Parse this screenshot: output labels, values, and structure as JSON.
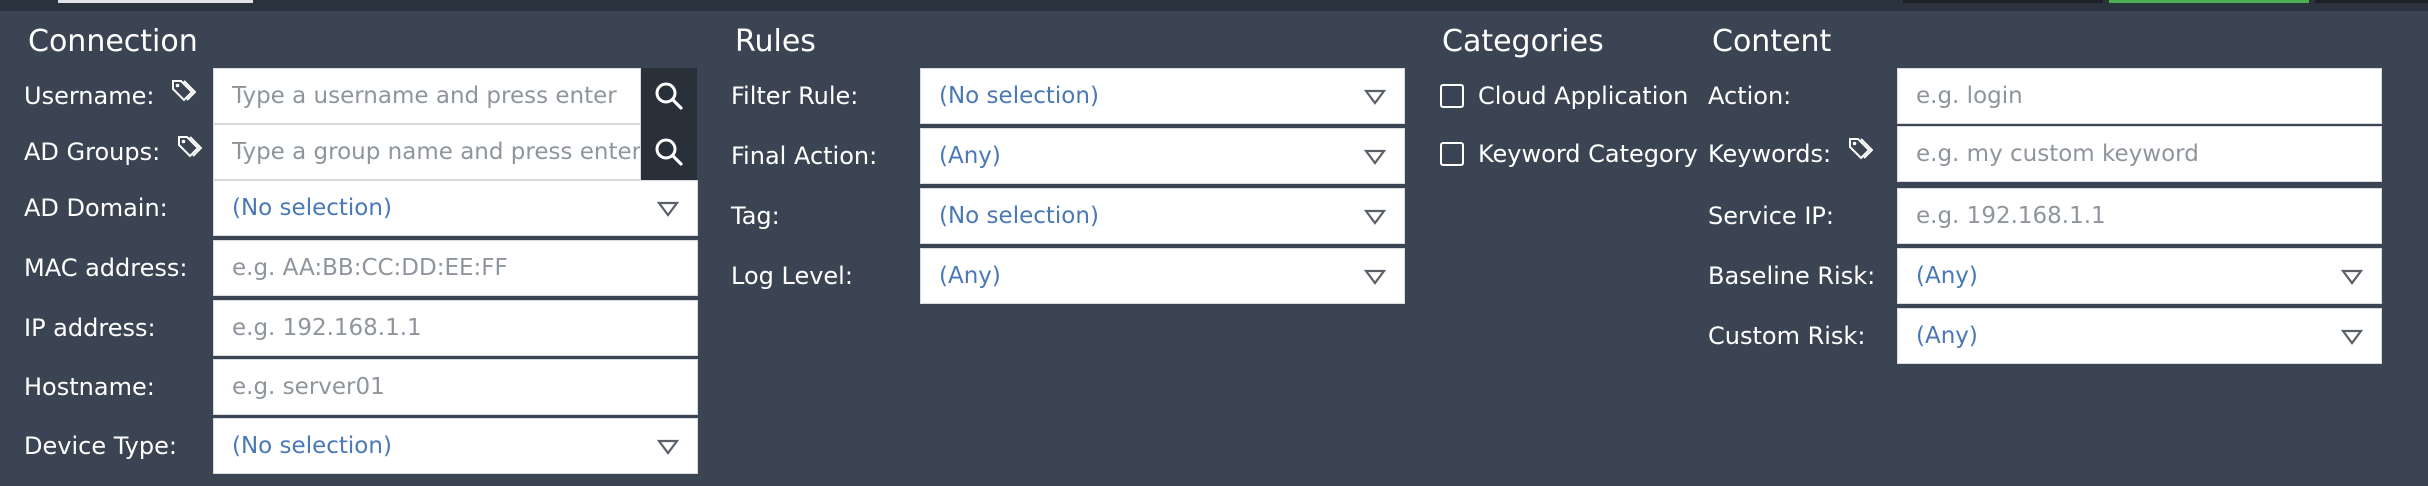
{
  "colors": {
    "background": "#3a4452",
    "field_background": "#ffffff",
    "placeholder_text": "#8f959c",
    "select_text": "#4a78b6",
    "search_button": "#2a3039",
    "top_tab_green": "#4caf50"
  },
  "connection": {
    "title": "Connection",
    "username": {
      "label": "Username:",
      "placeholder": "Type a username and press enter",
      "icon": "tag-icon"
    },
    "ad_groups": {
      "label": "AD Groups:",
      "placeholder": "Type a group name and press enter",
      "icon": "tag-icon"
    },
    "ad_domain": {
      "label": "AD Domain:",
      "value": "(No selection)"
    },
    "mac_address": {
      "label": "MAC address:",
      "placeholder": "e.g. AA:BB:CC:DD:EE:FF"
    },
    "ip_address": {
      "label": "IP address:",
      "placeholder": "e.g. 192.168.1.1"
    },
    "hostname": {
      "label": "Hostname:",
      "placeholder": "e.g. server01"
    },
    "device_type": {
      "label": "Device Type:",
      "value": "(No selection)"
    }
  },
  "rules": {
    "title": "Rules",
    "filter_rule": {
      "label": "Filter Rule:",
      "value": "(No selection)"
    },
    "final_action": {
      "label": "Final Action:",
      "value": "(Any)"
    },
    "tag": {
      "label": "Tag:",
      "value": "(No selection)"
    },
    "log_level": {
      "label": "Log Level:",
      "value": "(Any)"
    }
  },
  "categories": {
    "title": "Categories",
    "items": [
      {
        "label": "Cloud Application",
        "checked": false
      },
      {
        "label": "Keyword Category",
        "checked": false
      }
    ]
  },
  "content": {
    "title": "Content",
    "action": {
      "label": "Action:",
      "placeholder": "e.g. login"
    },
    "keywords": {
      "label": "Keywords:",
      "placeholder": "e.g. my custom keyword",
      "icon": "tag-icon"
    },
    "service_ip": {
      "label": "Service IP:",
      "placeholder": "e.g. 192.168.1.1"
    },
    "baseline_risk": {
      "label": "Baseline Risk:",
      "value": "(Any)"
    },
    "custom_risk": {
      "label": "Custom Risk:",
      "value": "(Any)"
    }
  }
}
